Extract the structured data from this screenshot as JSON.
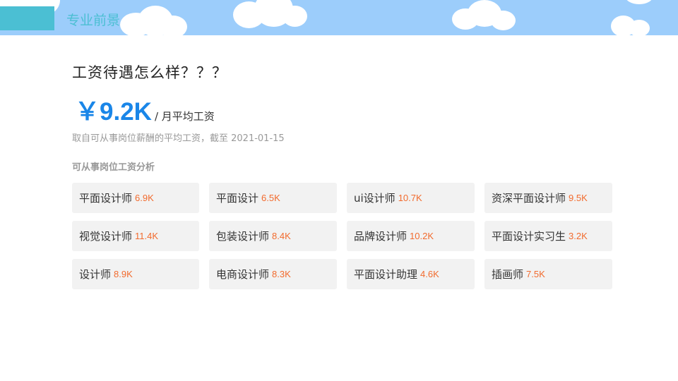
{
  "header": {
    "title": "专业前景"
  },
  "question": "工资待遇怎么样？？？",
  "salary": {
    "value": "￥9.2K",
    "unit": "/ 月平均工资"
  },
  "source_note": "取自可从事岗位薪酬的平均工资，截至 2021-01-15",
  "section_title": "可从事岗位工资分析",
  "jobs": [
    {
      "name": "平面设计师",
      "salary": "6.9K"
    },
    {
      "name": "平面设计",
      "salary": "6.5K"
    },
    {
      "name": "ui设计师",
      "salary": "10.7K"
    },
    {
      "name": "资深平面设计师",
      "salary": "9.5K"
    },
    {
      "name": "视觉设计师",
      "salary": "11.4K"
    },
    {
      "name": "包装设计师",
      "salary": "8.4K"
    },
    {
      "name": "品牌设计师",
      "salary": "10.2K"
    },
    {
      "name": "平面设计实习生",
      "salary": "3.2K"
    },
    {
      "name": "设计师",
      "salary": "8.9K"
    },
    {
      "name": "电商设计师",
      "salary": "8.3K"
    },
    {
      "name": "平面设计助理",
      "salary": "4.6K"
    },
    {
      "name": "插画师",
      "salary": "7.5K"
    }
  ],
  "colors": {
    "sky": "#9ccdfb",
    "accent": "#4bbfd3",
    "salary_blue": "#1a86e8",
    "chip_salary": "#f26b2e",
    "chip_bg": "#f2f2f2"
  }
}
